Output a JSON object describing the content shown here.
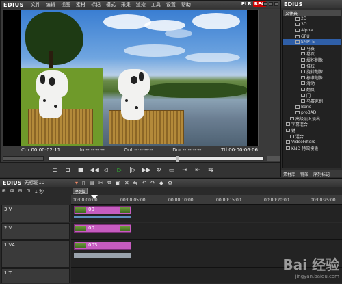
{
  "app": {
    "name": "EDIUS",
    "plr": "PLR",
    "rec": "REC"
  },
  "menu": [
    "文件",
    "编辑",
    "视图",
    "素材",
    "标记",
    "模式",
    "采集",
    "渲染",
    "工具",
    "设置",
    "帮助"
  ],
  "timecodes": {
    "cur_label": "Cur",
    "cur_value": "00:00:02:11",
    "in_label": "In",
    "in_value": "--:--:--:--",
    "out_label": "Out",
    "out_value": "--:--:--:--",
    "dur_label": "Dur",
    "dur_value": "--:--:--:--",
    "ttl_label": "Ttl",
    "ttl_value": "00:00:06:06"
  },
  "transport_icons": [
    "in-point-icon",
    "out-point-icon",
    "stop-icon",
    "rewind-icon",
    "step-back-icon",
    "play-icon",
    "step-forward-icon",
    "fast-forward-icon",
    "loop-icon",
    "output-icon",
    "insert-icon",
    "overwrite-icon",
    "replace-icon"
  ],
  "right_panel": {
    "title": "EDIUS",
    "tree_header": "文件夹",
    "tree_items": [
      {
        "label": "2D",
        "indent": 3
      },
      {
        "label": "3D",
        "indent": 3
      },
      {
        "label": "Alpha",
        "indent": 3
      },
      {
        "label": "GPU",
        "indent": 3
      },
      {
        "label": "SMPTE",
        "indent": 3,
        "selected": true
      },
      {
        "label": "马赛",
        "indent": 4
      },
      {
        "label": "卷页",
        "indent": 4
      },
      {
        "label": "爆炸划像",
        "indent": 4
      },
      {
        "label": "推拉",
        "indent": 4
      },
      {
        "label": "旋转划像",
        "indent": 4
      },
      {
        "label": "标准划像",
        "indent": 4
      },
      {
        "label": "滑动",
        "indent": 4
      },
      {
        "label": "翻页",
        "indent": 4
      },
      {
        "label": "门",
        "indent": 4
      },
      {
        "label": "马赛克划",
        "indent": 4
      },
      {
        "label": "Boris",
        "indent": 3
      },
      {
        "label": "pro3AD",
        "indent": 3
      },
      {
        "label": "高级淡入淡出",
        "indent": 2
      },
      {
        "label": "字幕混合",
        "indent": 1
      },
      {
        "label": "键",
        "indent": 1
      },
      {
        "label": "混合",
        "indent": 2
      },
      {
        "label": "VideoFilters",
        "indent": 1
      },
      {
        "label": "KND-特效模板",
        "indent": 1
      }
    ],
    "tabs": [
      "素材库",
      "特效",
      "序列标记"
    ]
  },
  "timeline": {
    "title": "EDIUS",
    "project": "无标题10",
    "sequence_tab": "序列1",
    "zoom_label": "1 秒",
    "ruler_ticks": [
      "00:00:00:00",
      "00:00:05:00",
      "00:00:10:00",
      "00:00:15:00",
      "00:00:20:00",
      "00:00:25:00"
    ],
    "tracks": [
      {
        "name": "3 V",
        "clip": "00"
      },
      {
        "name": "2 V",
        "clip": "00"
      },
      {
        "name": "1 VA",
        "clip": "003"
      },
      {
        "name": "1 T",
        "clip": ""
      }
    ]
  },
  "watermark": {
    "text": "Bai 经验",
    "sub": "jingyan.baidu.com"
  },
  "colors": {
    "clip": "#c65cc0",
    "rec": "#cc0000",
    "play": "#33cc33",
    "selection": "#2f5fa8"
  }
}
